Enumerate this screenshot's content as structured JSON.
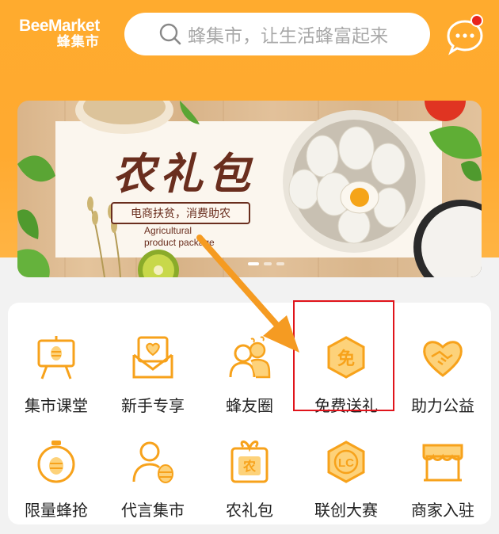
{
  "header": {
    "logo_en": "BeeMarket",
    "logo_cn": "蜂集市",
    "search_placeholder": "蜂集市，让生活蜂富起来"
  },
  "banner": {
    "title": "农礼包",
    "ribbon": "电商扶贫，消费助农",
    "subtitle_en_line1": "Agricultural",
    "subtitle_en_line2": "product package"
  },
  "menu": {
    "row1": [
      {
        "label": "集市课堂",
        "icon": "easel-icon"
      },
      {
        "label": "新手专享",
        "icon": "envelope-heart-icon"
      },
      {
        "label": "蜂友圈",
        "icon": "friends-icon"
      },
      {
        "label": "免费送礼",
        "icon": "free-badge-icon"
      },
      {
        "label": "助力公益",
        "icon": "heart-handshake-icon"
      }
    ],
    "row2": [
      {
        "label": "限量蜂抢",
        "icon": "stopwatch-icon"
      },
      {
        "label": "代言集市",
        "icon": "person-hive-icon"
      },
      {
        "label": "农礼包",
        "icon": "gift-box-icon"
      },
      {
        "label": "联创大赛",
        "icon": "lc-badge-icon"
      },
      {
        "label": "商家入驻",
        "icon": "storefront-icon"
      }
    ]
  },
  "colors": {
    "brand_orange": "#ffab2e",
    "icon_orange": "#f7a21b",
    "highlight_red": "#e0141b",
    "arrow_orange": "#f59b22"
  }
}
